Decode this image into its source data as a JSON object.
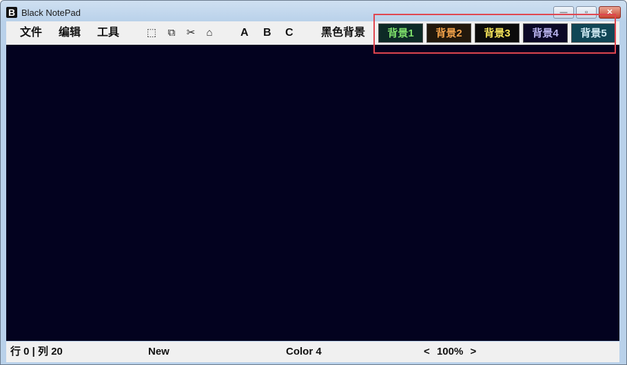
{
  "window": {
    "title": "Black NotePad",
    "icon_letter": "B"
  },
  "window_buttons": {
    "minimize": "—",
    "maximize": "▫",
    "close": "✕"
  },
  "menu": {
    "file": "文件",
    "edit": "编辑",
    "tools": "工具"
  },
  "tools": {
    "select_all": "⬚",
    "copy": "⧉",
    "cut": "✂",
    "paste": "⌂"
  },
  "fonts": {
    "a": "A",
    "b": "B",
    "c": "C"
  },
  "background": {
    "label": "黑色背景",
    "buttons": [
      {
        "label": "背景1",
        "bg": "#0d2a26",
        "fg": "#7ee06b"
      },
      {
        "label": "背景2",
        "bg": "#22180c",
        "fg": "#f1a14a"
      },
      {
        "label": "背景3",
        "bg": "#0b0b0b",
        "fg": "#f4e35a"
      },
      {
        "label": "背景4",
        "bg": "#0b0826",
        "fg": "#b9b3ee"
      },
      {
        "label": "背景5",
        "bg": "#114656",
        "fg": "#cfe9f2"
      }
    ]
  },
  "editor": {
    "content": "",
    "bg_color": "#03021f"
  },
  "status": {
    "position": "行 0 | 列 20",
    "mode": "New",
    "color": "Color 4",
    "zoom": "100%",
    "zoom_out": "<",
    "zoom_in": ">"
  }
}
